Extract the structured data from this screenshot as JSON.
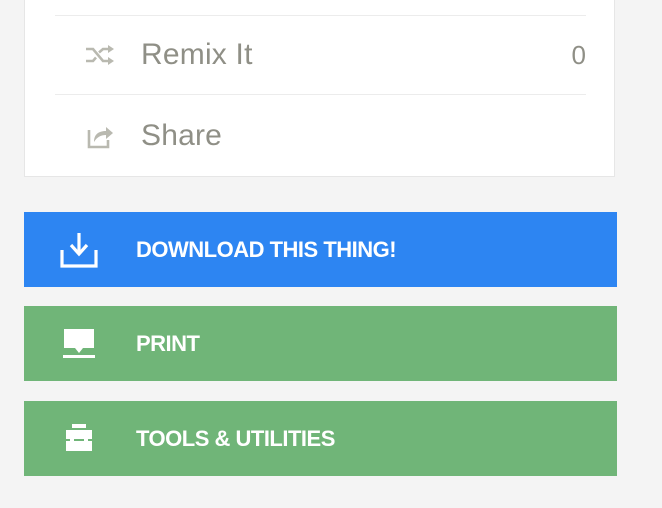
{
  "panel": {
    "remix": {
      "label": "Remix It",
      "count": "0",
      "icon": "shuffle-icon"
    },
    "share": {
      "label": "Share",
      "icon": "share-icon"
    }
  },
  "actions": {
    "download": {
      "label": "DOWNLOAD THIS THING!",
      "icon": "download-icon",
      "color": "#2d85f2"
    },
    "print": {
      "label": "PRINT",
      "icon": "printer-icon",
      "color": "#70b578"
    },
    "tools": {
      "label": "TOOLS & UTILITIES",
      "icon": "toolbox-icon",
      "color": "#70b578"
    }
  }
}
